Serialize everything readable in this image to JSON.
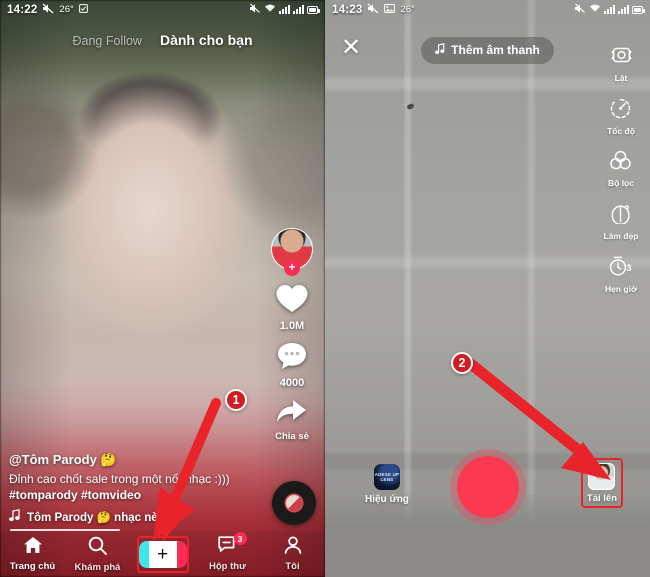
{
  "feed": {
    "status_bar": {
      "time": "14:22",
      "temperature": "26°",
      "icons": [
        "mute-icon",
        "weather-icon",
        "wifi-icon",
        "signal-icon",
        "signal-icon",
        "battery-icon"
      ]
    },
    "tabs": [
      {
        "label": "Đang Follow",
        "active": false
      },
      {
        "label": "Dành cho bạn",
        "active": true
      }
    ],
    "actions": {
      "follow_plus": "+",
      "like_count": "1.0M",
      "comment_count": "4000",
      "share_label": "Chia sẻ"
    },
    "caption": {
      "username": "@Tôm Parody 🤔",
      "description": "Đỉnh cao chốt sale trong một nốt nhạc :)))",
      "hashtags": "#tomparody #tomvideo",
      "music": "Tôm Parody 🤔      nhạc nè"
    },
    "bottom_nav": [
      {
        "label": "Trang chủ",
        "icon": "home-icon",
        "active": true
      },
      {
        "label": "Khám phá",
        "icon": "search-icon",
        "active": false
      },
      {
        "label": "",
        "icon": "create-plus-icon",
        "active": false
      },
      {
        "label": "Hộp thư",
        "icon": "inbox-icon",
        "badge": "3",
        "active": false
      },
      {
        "label": "Tôi",
        "icon": "profile-icon",
        "active": false
      }
    ]
  },
  "camera": {
    "status_bar": {
      "time": "14:23",
      "temperature": "26°",
      "icons": [
        "mute-icon",
        "weather-icon",
        "image-icon",
        "wifi-icon",
        "signal-icon",
        "signal-icon",
        "battery-icon"
      ]
    },
    "close_label": "✕",
    "sound_button": "Thêm âm thanh",
    "side_tools": [
      {
        "label": "Lật",
        "icon": "camera-flip-icon"
      },
      {
        "label": "Tốc độ",
        "icon": "speed-icon"
      },
      {
        "label": "Bộ lọc",
        "icon": "filter-icon"
      },
      {
        "label": "Làm đẹp",
        "icon": "beauty-icon"
      },
      {
        "label": "Hẹn giờ",
        "icon": "timer-icon",
        "value": "3"
      }
    ],
    "effects_label": "Hiệu ứng",
    "effects_thumb_text": "ADESE UP LENS",
    "upload_label": "Tải lên",
    "record_label": "record-button"
  },
  "annotations": {
    "steps": [
      {
        "number": "1",
        "target": "create-plus-button"
      },
      {
        "number": "2",
        "target": "upload-button"
      }
    ],
    "highlight_color": "#e8232a",
    "arrow_color": "#e8232a"
  }
}
